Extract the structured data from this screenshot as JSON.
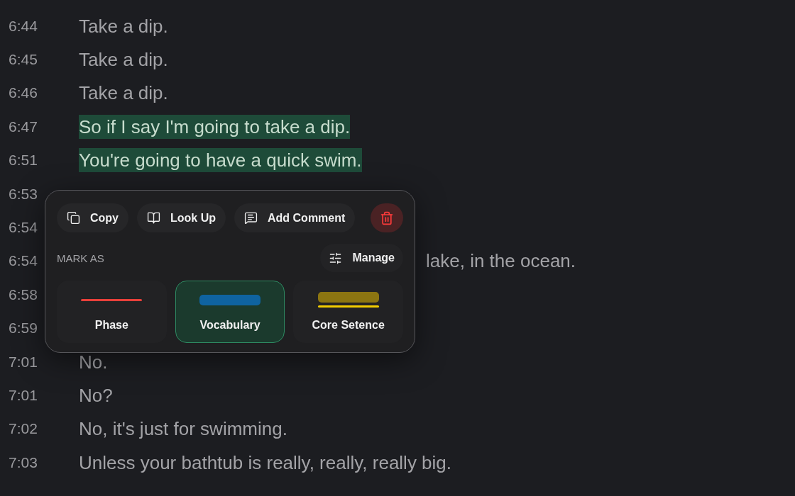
{
  "transcript": [
    {
      "time": "6:44",
      "text": "Take a dip.",
      "selected": false
    },
    {
      "time": "6:45",
      "text": "Take a dip.",
      "selected": false
    },
    {
      "time": "6:46",
      "text": "Take a dip.",
      "selected": false
    },
    {
      "time": "6:47",
      "text": "So if I say I'm going to take a dip.",
      "selected": true
    },
    {
      "time": "6:51",
      "text": "You're going to have a quick swim.",
      "selected": true
    },
    {
      "time": "6:53"
    },
    {
      "time": "6:54"
    },
    {
      "time": "6:54",
      "text": "lake, in the ocean.",
      "kind": "behind_popup",
      "selected": false
    },
    {
      "time": "6:58"
    },
    {
      "time": "6:59"
    },
    {
      "time": "7:01",
      "text": "No.",
      "selected": false
    },
    {
      "time": "7:01",
      "text": "No?",
      "selected": false
    },
    {
      "time": "7:02",
      "text": "No, it's just for swimming.",
      "selected": false
    },
    {
      "time": "7:03",
      "text": "Unless your bathtub is really, really, really big.",
      "selected": false
    }
  ],
  "popup": {
    "actions": [
      {
        "kind": "copy",
        "label": "Copy"
      },
      {
        "kind": "lookup",
        "label": "Look Up"
      },
      {
        "kind": "comment",
        "label": "Add Comment"
      },
      {
        "kind": "delete"
      }
    ],
    "mark_as_label": "MARK AS",
    "manage": "Manage",
    "marks": [
      {
        "label": "Phase",
        "swatches": [
          {
            "kind": "underline",
            "color": "#e8403a"
          }
        ],
        "selected": false
      },
      {
        "label": "Vocabulary",
        "swatches": [
          {
            "kind": "highlight",
            "color": "#0f63a0"
          }
        ],
        "selected": true
      },
      {
        "label": "Core Setence",
        "swatches": [
          {
            "kind": "highlight",
            "color": "#8c7511"
          },
          {
            "kind": "underline",
            "color": "#f4cd00"
          }
        ],
        "selected": false
      }
    ]
  }
}
